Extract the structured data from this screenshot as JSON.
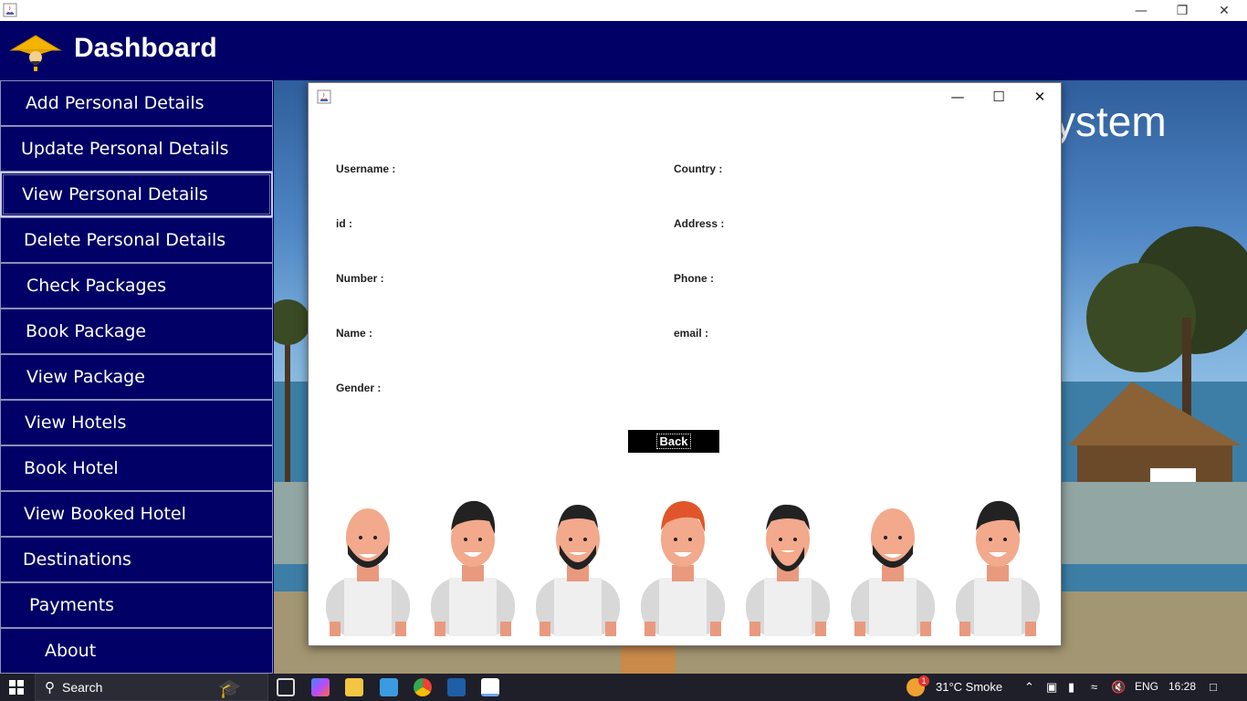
{
  "app": {
    "header_title": "Dashboard"
  },
  "sidebar": {
    "items": [
      {
        "label": "Add Personal Details"
      },
      {
        "label": "Update Personal Details"
      },
      {
        "label": "View Personal Details"
      },
      {
        "label": "Delete Personal Details"
      },
      {
        "label": "Check Packages"
      },
      {
        "label": "Book Package"
      },
      {
        "label": "View Package"
      },
      {
        "label": "View Hotels"
      },
      {
        "label": "Book Hotel"
      },
      {
        "label": "View Booked Hotel"
      },
      {
        "label": "Destinations"
      },
      {
        "label": "Payments"
      },
      {
        "label": "About"
      }
    ],
    "selected": "View Personal Details"
  },
  "background": {
    "partial_title": "ystem"
  },
  "dialog": {
    "fields_left": [
      "Username :",
      "id :",
      "Number :",
      "Name :",
      "Gender :"
    ],
    "fields_right": [
      "Country :",
      "Address :",
      "Phone :",
      "email :"
    ],
    "back_label": "Back"
  },
  "taskbar": {
    "search_placeholder": "Search",
    "weather": "31°C  Smoke",
    "weather_badge": "1",
    "language": "ENG",
    "time": "16:28"
  },
  "colors": {
    "header": "#000066",
    "sidebar": "#000066",
    "back_button": "#000000"
  }
}
